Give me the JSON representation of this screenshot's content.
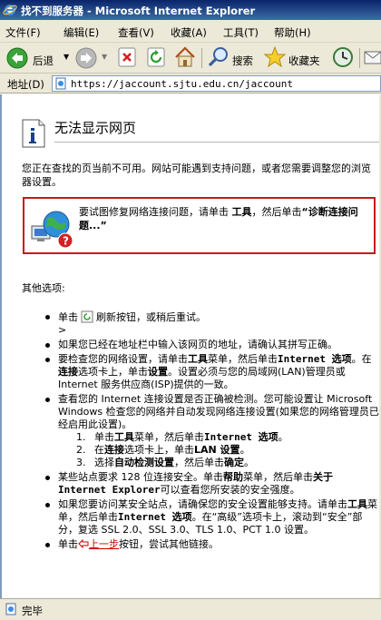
{
  "window": {
    "title": "找不到服务器 - Microsoft Internet Explorer"
  },
  "menu": [
    "文件(F)",
    "编辑(E)",
    "查看(V)",
    "收藏(A)",
    "工具(T)",
    "帮助(H)"
  ],
  "toolbar": {
    "back_label": "后退",
    "search_label": "搜索",
    "favorites_label": "收藏夹"
  },
  "address": {
    "label": "地址(D)",
    "url": "https://jaccount.sjtu.edu.cn/jaccount"
  },
  "page": {
    "title": "无法显示网页",
    "intro": "您正在查找的页当前不可用。网站可能遇到支持问题，或者您需要调整您的浏览器设置。",
    "diagnose_1": "要试图修复网络连接问题，请单击 ",
    "diagnose_tools": "工具",
    "diagnose_2": "，然后单击",
    "diagnose_quote": "“诊断连接问题...”",
    "other_options": "其他选项:",
    "opt1_a": "单击",
    "opt1_b": "刷新按钮，或稍后重试。",
    "opt1_c": ">",
    "opt2": "如果您已经在地址栏中输入该网页的地址，请确认其拼写正确。",
    "opt3_a": "要检查您的网络设置，请单击",
    "opt3_tools": "工具",
    "opt3_b": "菜单，然后单击",
    "opt3_io": "Internet 选项",
    "opt3_c": "。在",
    "opt3_conn": "连接",
    "opt3_d": "选项卡上，单击",
    "opt3_settings": "设置",
    "opt3_e": "。设置必须与您的局域网(LAN)管理员或 Internet 服务供应商(ISP)提供的一致。",
    "opt4": "查看您的 Internet 连接设置是否正确被检测。您可能设置让 Microsoft Windows 检查您的网络并自动发现网络连接设置(如果您的网络管理员已经启用此设置)。",
    "sub1_num": "1.",
    "sub1_a": "单击",
    "sub1_tools": "工具",
    "sub1_b": "菜单，然后单击",
    "sub1_io": "Internet 选项",
    "sub1_c": "。",
    "sub2_num": "2.",
    "sub2_a": "在",
    "sub2_conn": "连接",
    "sub2_b": "选项卡上，单击",
    "sub2_lan": "LAN 设置",
    "sub2_c": "。",
    "sub3_num": "3.",
    "sub3_a": "选择",
    "sub3_auto": "自动检测设置",
    "sub3_b": "，然后单击",
    "sub3_ok": "确定",
    "sub3_c": "。",
    "opt5_a": "某些站点要求 128 位连接安全。单击",
    "opt5_help": "帮助",
    "opt5_b": "菜单，然后单击",
    "opt5_about": "关于 Internet Explorer",
    "opt5_c": "可以查看您所安装的安全强度。",
    "opt6_a": "如果您要访问某安全站点，请确保您的安全设置能够支持。请单击",
    "opt6_tools": "工具",
    "opt6_b": "菜单，然后单击",
    "opt6_io": "Internet 选项",
    "opt6_c": "。在“高级”选项卡上，滚动到“安全”部分，复选 SSL 2.0、SSL 3.0、TLS 1.0、PCT 1.0 设置。",
    "opt7_a": "单击",
    "opt7_link": "上一步",
    "opt7_b": "按钮，尝试其他链接。"
  },
  "status": {
    "text": "完毕"
  },
  "colors": {
    "title_bar": "#0a246a",
    "chrome": "#ece9d8",
    "diagnose_border": "#c41b1b",
    "link": "#c40000"
  }
}
